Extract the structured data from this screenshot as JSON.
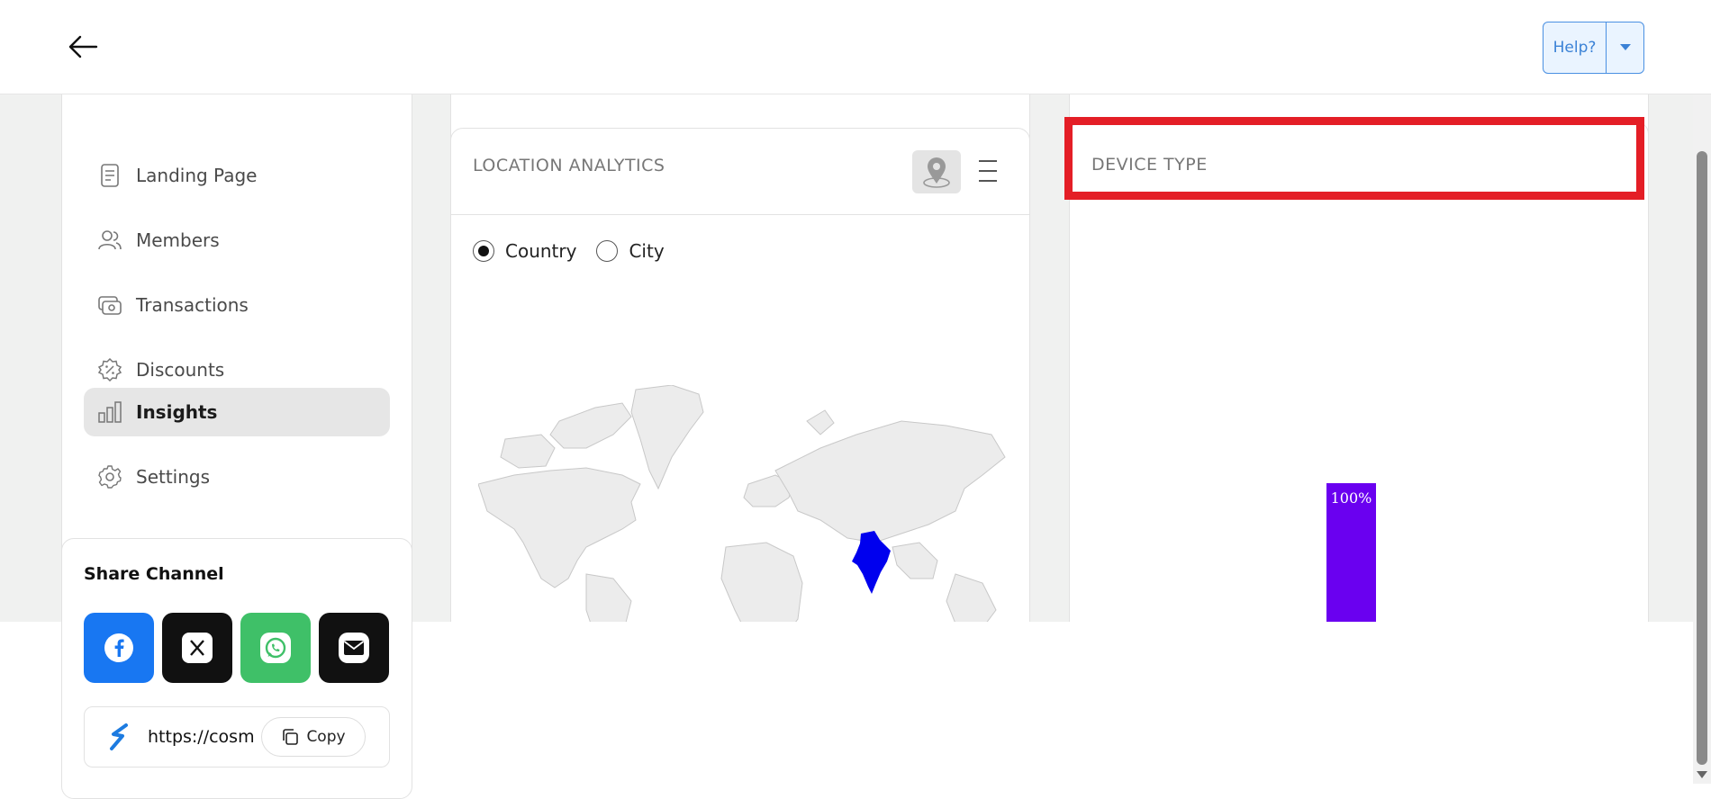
{
  "topbar": {
    "back_icon": "arrow-left-icon",
    "help_label": "Help?",
    "help_dropdown_icon": "caret-down-icon"
  },
  "sidebar": {
    "items": [
      {
        "label": "Landing Page",
        "icon": "document-icon"
      },
      {
        "label": "Members",
        "icon": "users-icon"
      },
      {
        "label": "Transactions",
        "icon": "wallet-icon"
      },
      {
        "label": "Discounts",
        "icon": "discount-badge-icon"
      },
      {
        "label": "Insights",
        "icon": "bar-chart-icon",
        "active": true
      },
      {
        "label": "Settings",
        "icon": "gear-icon"
      }
    ]
  },
  "share": {
    "title": "Share Channel",
    "channels": [
      {
        "name": "facebook",
        "color": "#1877f2"
      },
      {
        "name": "x",
        "color": "#111111"
      },
      {
        "name": "whatsapp",
        "color": "#3fc068"
      },
      {
        "name": "email",
        "color": "#111111"
      }
    ],
    "link_text": "https://cosm",
    "copy_label": "Copy"
  },
  "location": {
    "title": "LOCATION ANALYTICS",
    "options": [
      "Country",
      "City"
    ],
    "selected": "Country",
    "highlight_color": "#0000ee"
  },
  "device": {
    "title": "DEVICE TYPE",
    "highlight_color": "#e41e26"
  },
  "chart_data": {
    "type": "bar",
    "categories": [
      ""
    ],
    "values": [
      100
    ],
    "data_labels": [
      "100%"
    ],
    "color": "#6a00f0"
  }
}
